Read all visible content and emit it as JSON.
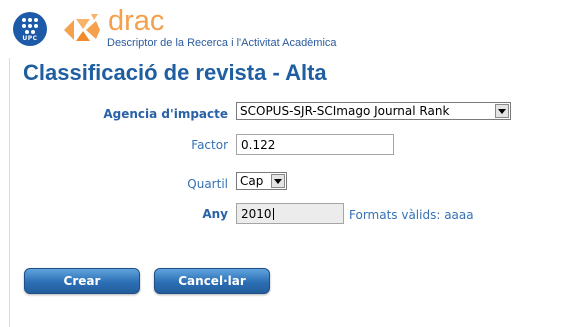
{
  "header": {
    "upc_logo_text": "UPC",
    "app_name": "drac",
    "app_subtitle": "Descriptor de la Recerca i l'Activitat Acadèmica"
  },
  "page": {
    "title": "Classificació de revista - Alta"
  },
  "form": {
    "agency": {
      "label": "Agencia d'impacte",
      "value": "SCOPUS-SJR-SCImago Journal Rank"
    },
    "factor": {
      "label": "Factor",
      "value": "0.122"
    },
    "quartile": {
      "label": "Quartil",
      "value": "Cap"
    },
    "year": {
      "label": "Any",
      "value": "2010",
      "hint": "Formats vàlids: aaaa"
    }
  },
  "buttons": {
    "create": "Crear",
    "cancel": "Cancel·lar"
  },
  "colors": {
    "accent_blue": "#1f5ea1",
    "label_blue": "#3572b5",
    "brand_orange": "#f5a04d"
  }
}
